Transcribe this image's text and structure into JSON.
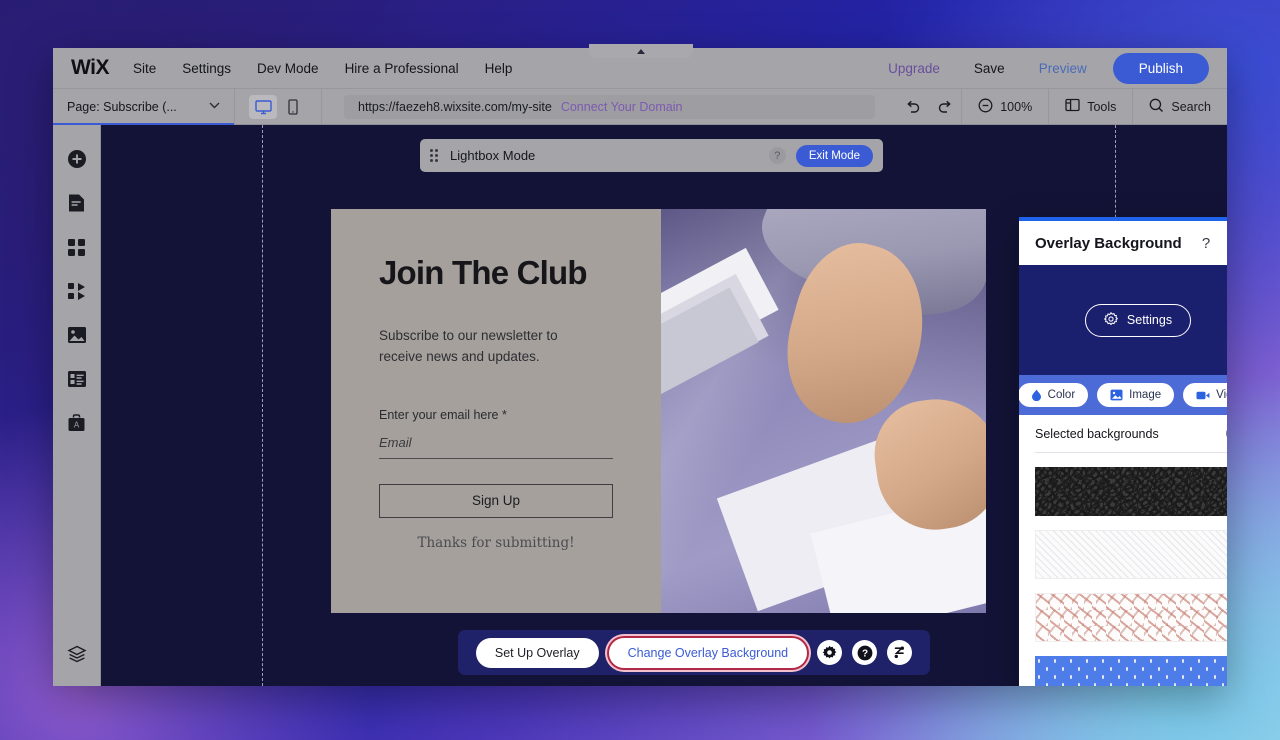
{
  "topbar": {
    "logo": "WiX",
    "menu": [
      {
        "label": "Site"
      },
      {
        "label": "Settings"
      },
      {
        "label": "Dev Mode"
      },
      {
        "label": "Hire a Professional"
      },
      {
        "label": "Help"
      }
    ],
    "upgrade": "Upgrade",
    "save": "Save",
    "preview": "Preview",
    "publish": "Publish"
  },
  "secondbar": {
    "page_label": "Page: Subscribe (...",
    "chevron": "chevron-down-icon",
    "url": "https://faezeh8.wixsite.com/my-site",
    "domain_link": "Connect Your Domain",
    "zoom": "100%",
    "tools": "Tools",
    "search": "Search"
  },
  "sidebar": {
    "items": [
      {
        "name": "add-elements",
        "icon": "plus-circle-icon"
      },
      {
        "name": "pages",
        "icon": "page-icon"
      },
      {
        "name": "app-market",
        "icon": "apps-grid-icon"
      },
      {
        "name": "add-apps",
        "icon": "add-apps-icon"
      },
      {
        "name": "media",
        "icon": "image-icon"
      },
      {
        "name": "blog",
        "icon": "content-manager-icon"
      },
      {
        "name": "business",
        "icon": "business-icon"
      }
    ],
    "bottom": {
      "name": "layers",
      "icon": "layers-icon"
    }
  },
  "lightbox_mode": {
    "label": "Lightbox Mode",
    "help": "?",
    "exit": "Exit Mode"
  },
  "lightbox_content": {
    "title": "Join The Club",
    "subtitle": "Subscribe to our newsletter to receive news and updates.",
    "field_label": "Enter your email here *",
    "field_placeholder": "Email",
    "submit": "Sign Up",
    "thanks": "Thanks for submitting!"
  },
  "floatbar": {
    "setup": "Set Up Overlay",
    "change": "Change Overlay Background",
    "icons": [
      {
        "name": "settings-gear-icon"
      },
      {
        "name": "help-icon"
      },
      {
        "name": "animation-icon"
      }
    ]
  },
  "panel": {
    "title": "Overlay Background",
    "help": "?",
    "close": "×",
    "settings": "Settings",
    "tabs": [
      {
        "label": "Color",
        "icon": "droplet-icon"
      },
      {
        "label": "Image",
        "icon": "image-icon"
      },
      {
        "label": "Video",
        "icon": "video-camera-icon"
      }
    ],
    "section_title": "Selected backgrounds",
    "info": "i",
    "thumbnails": [
      {
        "name": "dark-squiggle-pattern"
      },
      {
        "name": "light-diagonal-stripes-pattern"
      },
      {
        "name": "light-scattered-dots-pattern"
      },
      {
        "name": "blue-polka-dots-pattern"
      }
    ]
  },
  "colors": {
    "accent_blue": "#3b5bd4",
    "panel_blue": "#1e63e9",
    "canvas_navy": "#131338",
    "highlight_red": "#b02a47",
    "upgrade_purple": "#6a4e9c"
  }
}
